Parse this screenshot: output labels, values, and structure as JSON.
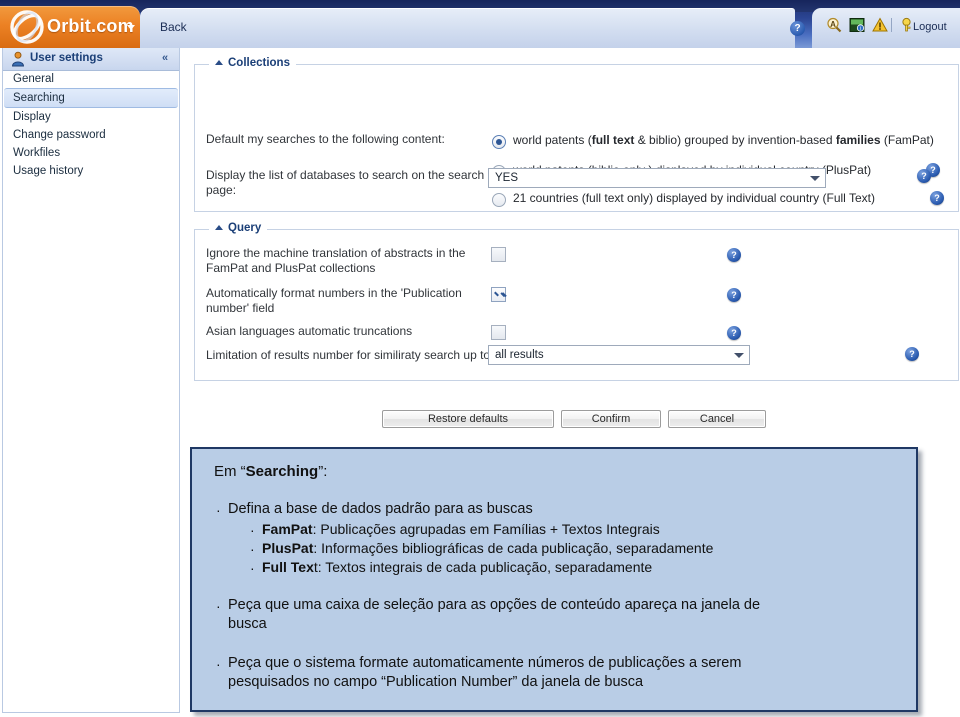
{
  "topbar": {
    "brand": "Orbit.com",
    "brand_caret": "▾",
    "back_label": "Back",
    "help_glyph": "?",
    "logout_label": "Logout",
    "icons": [
      "font-size-icon",
      "calendar-icon",
      "warning-icon",
      "key-icon"
    ]
  },
  "sidebar": {
    "header": "User settings",
    "collapse_glyph": "«",
    "items": [
      {
        "label": "General",
        "active": false
      },
      {
        "label": "Searching",
        "active": true
      },
      {
        "label": "Display",
        "active": false
      },
      {
        "label": "Change password",
        "active": false
      },
      {
        "label": "Workfiles",
        "active": false
      },
      {
        "label": "Usage history",
        "active": false
      }
    ]
  },
  "collections": {
    "legend": "Collections",
    "default_label": "Default my searches to the following content:",
    "options": [
      {
        "pre": "world patents (",
        "b1": "full text",
        "mid": " & biblio) grouped by invention-based ",
        "b2": "families",
        "post": " (FamPat)",
        "selected": true,
        "help": false
      },
      {
        "pre": "world patents (biblio only ) displayed by individual country (PlusPat)",
        "b1": "",
        "mid": "",
        "b2": "",
        "post": "",
        "selected": false,
        "help": true
      },
      {
        "pre": "21 countries (full text only) displayed by individual country (Full Text)",
        "b1": "",
        "mid": "",
        "b2": "",
        "post": "",
        "selected": false,
        "help": true
      }
    ],
    "display_list_label_1": "Display the list of databases to search on the search",
    "display_list_label_2": "page:",
    "display_list_value": "YES",
    "help_glyph": "?"
  },
  "query": {
    "legend": "Query",
    "rows": [
      {
        "line1": "Ignore the machine translation of abstracts in the",
        "line2": "FamPat and PlusPat collections",
        "checked": false
      },
      {
        "line1": "Automatically format numbers in the 'Publication",
        "line2": "number' field",
        "checked": true
      },
      {
        "line1": "Asian languages automatic truncations",
        "line2": "",
        "checked": false
      }
    ],
    "limit_label": "Limitation of results number for similiraty search up to",
    "limit_value": "all results",
    "help_glyph": "?"
  },
  "buttons": {
    "restore": "Restore defaults",
    "confirm": "Confirm",
    "cancel": "Cancel"
  },
  "callout": {
    "title_pre": "Em “",
    "title_bold": "Searching",
    "title_post": "”:",
    "bullet_glyph": "·",
    "item1": "Defina a base de dados padrão para as buscas",
    "sub1_bold": "FamPat",
    "sub1_rest": ": Publicações agrupadas em Famílias + Textos Integrais",
    "sub2_bold": "PlusPat",
    "sub2_rest": ": Informações bibliográficas de cada publicação, separadamente",
    "sub3_bold": "Full Tex",
    "sub3_rest": "t: Textos integrais de cada publicação, separadamente",
    "item2_l1": "Peça que uma caixa de seleção para as opções de conteúdo apareça na janela de",
    "item2_l2": "busca",
    "item3_l1": "Peça que o sistema formate automaticamente números de publicações a serem",
    "item3_l2": "pesquisados no campo “Publication Number” da janela de busca"
  },
  "colors": {
    "brand_orange": "#ec8124",
    "header_blue": "#2b4593",
    "callout_fill": "#b9cde6",
    "callout_border": "#1f3864",
    "legend_navy": "#1b3f77"
  }
}
